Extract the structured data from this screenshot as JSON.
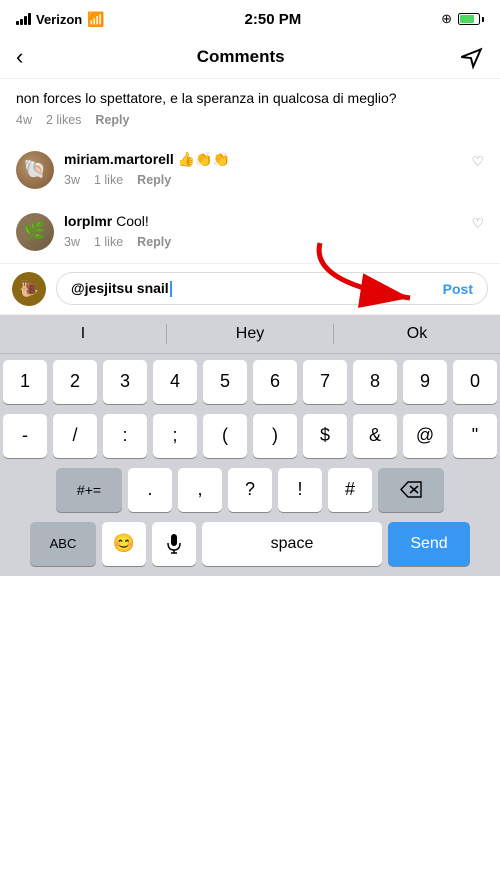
{
  "statusBar": {
    "carrier": "Verizon",
    "time": "2:50 PM",
    "wifi": "wifi",
    "batteryLevel": 80
  },
  "navBar": {
    "title": "Comments",
    "backLabel": "‹",
    "sendLabel": "send"
  },
  "truncatedComment": {
    "text": "non forces lo spettatore, e la speranza in qualcosa di meglio?",
    "timeAgo": "4w",
    "likes": "2 likes",
    "replyLabel": "Reply"
  },
  "comments": [
    {
      "username": "miriam.martorell",
      "text": " 👍👏👏",
      "timeAgo": "3w",
      "likes": "1 like",
      "replyLabel": "Reply",
      "avatarType": "miriam"
    },
    {
      "username": "lorplmr",
      "text": " Cool!",
      "timeAgo": "3w",
      "likes": "1 like",
      "replyLabel": "Reply",
      "avatarType": "lorplmr"
    }
  ],
  "commentInput": {
    "mention": "@jesjitsu snail",
    "postLabel": "Post",
    "cursorChar": "|"
  },
  "suggestions": [
    "I",
    "Hey",
    "Ok"
  ],
  "keyboard": {
    "row1": [
      "1",
      "2",
      "3",
      "4",
      "5",
      "6",
      "7",
      "8",
      "9",
      "0"
    ],
    "row2": [
      "-",
      "/",
      ":",
      ";",
      "(",
      ")",
      "$",
      "&",
      "@",
      "\""
    ],
    "row3Left": [
      "#+="
    ],
    "row3Mid": [
      ".",
      "  ,  ",
      "?",
      "!",
      "#"
    ],
    "row3DeleteLabel": "⌫",
    "row4": [
      "ABC",
      "😊",
      "🎤",
      "space",
      "Send"
    ]
  },
  "arrow": {
    "label": "red arrow pointing to input"
  }
}
